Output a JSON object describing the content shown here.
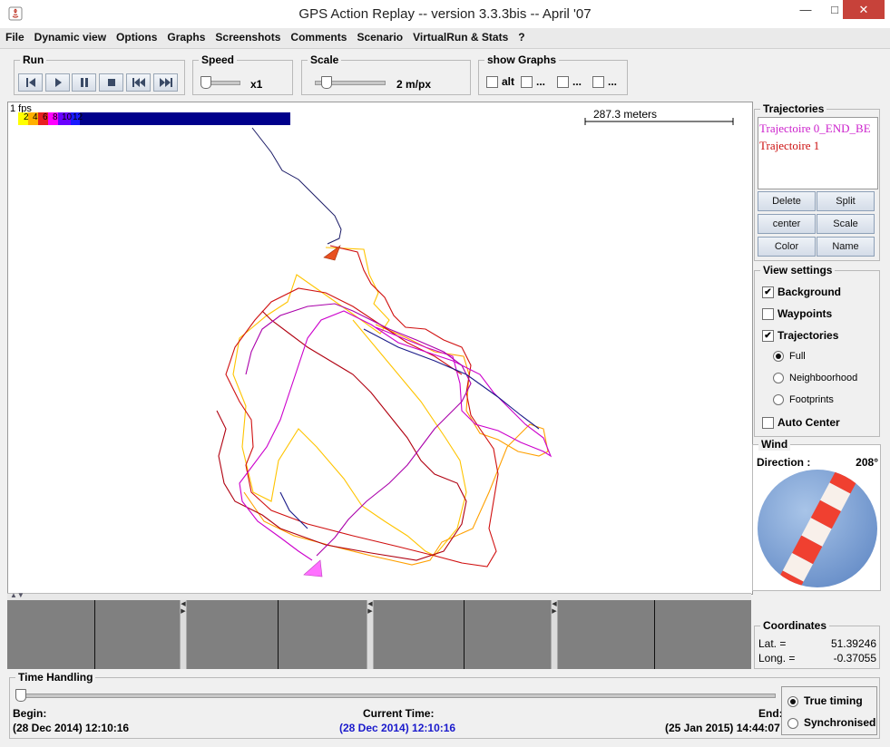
{
  "window": {
    "title": "GPS Action Replay -- version 3.3.3bis -- April '07"
  },
  "menu": [
    "File",
    "Dynamic view",
    "Options",
    "Graphs",
    "Screenshots",
    "Comments",
    "Scenario",
    "VirtualRun & Stats",
    "?"
  ],
  "run": {
    "label": "Run"
  },
  "speed": {
    "label": "Speed",
    "value": "x1",
    "level": 0.0
  },
  "scale": {
    "label": "Scale",
    "value": "2 m/px",
    "level": 0.1
  },
  "show_graphs": {
    "label": "show Graphs",
    "items": [
      "alt",
      "...",
      "...",
      "..."
    ]
  },
  "map": {
    "fps": "1 fps",
    "legend": [
      "2",
      "4",
      "6",
      "8",
      "10",
      "12"
    ],
    "scale_text": "287.3 meters"
  },
  "trajectories": {
    "label": "Trajectories",
    "items": [
      {
        "name": "Trajectoire 0_END_BE",
        "color": "#cc22cc"
      },
      {
        "name": "Trajectoire 1",
        "color": "#cc1111"
      }
    ],
    "buttons": {
      "delete": "Delete",
      "split": "Split",
      "center": "center",
      "scale": "Scale",
      "color": "Color",
      "name": "Name"
    }
  },
  "view_settings": {
    "label": "View settings",
    "background": "Background",
    "waypoints": "Waypoints",
    "trajectories": "Trajectories",
    "full": "Full",
    "neighbourhood": "Neighboorhood",
    "footprints": "Footprints",
    "auto_center": "Auto Center"
  },
  "wind": {
    "label": "Wind",
    "direction_label": "Direction :",
    "direction_value": "208°"
  },
  "coordinates": {
    "label": "Coordinates",
    "lat_label": "Lat. =",
    "lat": "51.39246",
    "long_label": "Long. =",
    "long": "-0.37055"
  },
  "time": {
    "label": "Time Handling",
    "begin_label": "Begin:",
    "begin": "(28 Dec 2014) 12:10:16",
    "current_label": "Current Time:",
    "current": "(28 Dec 2014) 12:10:16",
    "end_label": "End:",
    "end": "(25 Jan 2015) 14:44:07",
    "true_timing": "True timing",
    "synchronised": "Synchronised",
    "position": 0.0
  }
}
